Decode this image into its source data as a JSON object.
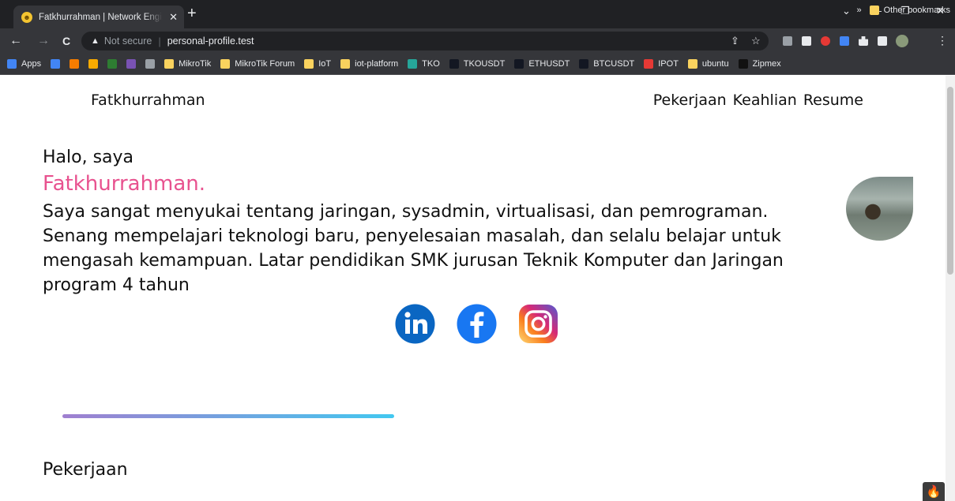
{
  "browser": {
    "tab_title": "Fatkhurrahman | Network Engineer",
    "tab_close": "✕",
    "new_tab": "+",
    "window_controls": [
      "⌄",
      "—",
      "❐",
      "✕"
    ],
    "nav": {
      "back": "←",
      "forward": "→",
      "reload": "C"
    },
    "security_label": "Not secure",
    "url": "personal-profile.test",
    "bookmarks": [
      {
        "label": "Apps",
        "icon": "apps-grid-icon",
        "color": "#4285f4"
      },
      {
        "label": "",
        "icon": "docs-icon",
        "color": "#4285f4"
      },
      {
        "label": "",
        "icon": "blogger-icon",
        "color": "#f57c00"
      },
      {
        "label": "",
        "icon": "analytics-icon",
        "color": "#f9ab00"
      },
      {
        "label": "",
        "icon": "w-icon",
        "color": "#2e7d32"
      },
      {
        "label": "",
        "icon": "bootstrap-icon",
        "color": "#7952b3"
      },
      {
        "label": "",
        "icon": "car-icon",
        "color": "#9aa0a6"
      },
      {
        "label": "MikroTik",
        "icon": "folder-icon",
        "color": "#f9d25e"
      },
      {
        "label": "MikroTik Forum",
        "icon": "folder-icon",
        "color": "#f9d25e"
      },
      {
        "label": "IoT",
        "icon": "folder-icon",
        "color": "#f9d25e"
      },
      {
        "label": "iot-platform",
        "icon": "folder-icon",
        "color": "#f9d25e"
      },
      {
        "label": "TKO",
        "icon": "tko-icon",
        "color": "#26a69a"
      },
      {
        "label": "TKOUSDT",
        "icon": "tradingview-icon",
        "color": "#131722"
      },
      {
        "label": "ETHUSDT",
        "icon": "tradingview-icon",
        "color": "#131722"
      },
      {
        "label": "BTCUSDT",
        "icon": "tradingview-icon",
        "color": "#131722"
      },
      {
        "label": "IPOT",
        "icon": "ipot-icon",
        "color": "#e53935"
      },
      {
        "label": "ubuntu",
        "icon": "folder-icon",
        "color": "#f9d25e"
      },
      {
        "label": "Zipmex",
        "icon": "zipmex-icon",
        "color": "#111111"
      }
    ],
    "bookmarks_overflow": "»",
    "other_bookmarks": "Other bookmarks"
  },
  "site": {
    "brand": "Fatkhurrahman",
    "nav": [
      "Pekerjaan",
      "Keahlian",
      "Resume"
    ]
  },
  "hero": {
    "greeting": "Halo, saya",
    "name": "Fatkhurrahman.",
    "bio": "Saya sangat menyukai tentang jaringan, sysadmin, virtualisasi, dan pemrograman. Senang mempelajari teknologi baru, penyelesaian masalah, dan selalu belajar untuk mengasah kemampuan. Latar pendidikan SMK jurusan Teknik Komputer dan Jaringan program 4 tahun"
  },
  "social": [
    {
      "name": "linkedin-icon",
      "color": "#0a66c2"
    },
    {
      "name": "facebook-icon",
      "color": "#1877f2"
    },
    {
      "name": "instagram-icon",
      "color": "#e1306c"
    }
  ],
  "sections": {
    "work_title": "Pekerjaan"
  },
  "colors": {
    "accent": "#e8528f",
    "divider_start": "#a07fd0",
    "divider_end": "#42c8f0"
  }
}
